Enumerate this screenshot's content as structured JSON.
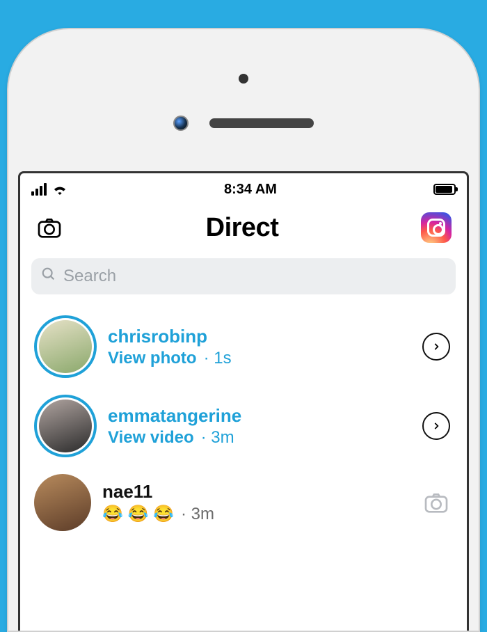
{
  "status": {
    "time": "8:34 AM"
  },
  "header": {
    "title": "Direct"
  },
  "search": {
    "placeholder": "Search"
  },
  "chats": [
    {
      "username": "chrisrobinp",
      "action": "View photo",
      "time": "1s",
      "unread": true,
      "trailing": "chevron"
    },
    {
      "username": "emmatangerine",
      "action": "View video",
      "time": "3m",
      "unread": true,
      "trailing": "chevron"
    },
    {
      "username": "nae11",
      "action": "😂 😂 😂",
      "time": "3m",
      "unread": false,
      "trailing": "camera"
    }
  ],
  "colors": {
    "accent": "#1fa1d8"
  }
}
